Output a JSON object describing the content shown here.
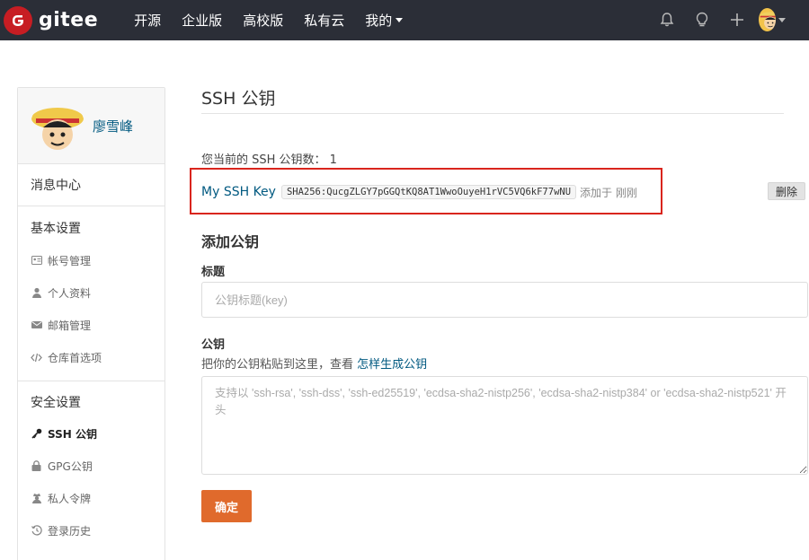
{
  "brand": {
    "name": "gitee",
    "color": "#c71d23"
  },
  "nav": {
    "links": [
      "开源",
      "企业版",
      "高校版",
      "私有云",
      "我的"
    ],
    "icons": [
      "bell-icon",
      "lightbulb-icon",
      "plus-icon",
      "user-avatar"
    ]
  },
  "sidebar": {
    "user_name": "廖雪峰",
    "message_center": "消息中心",
    "basic_header": "基本设置",
    "basic_items": [
      "帐号管理",
      "个人资料",
      "邮箱管理",
      "仓库首选项"
    ],
    "security_header": "安全设置",
    "security_items": [
      "SSH 公钥",
      "GPG公钥",
      "私人令牌",
      "登录历史"
    ]
  },
  "main": {
    "title": "SSH 公钥",
    "key_count_label": "您当前的 SSH 公钥数： 1",
    "key": {
      "name": "My SSH Key",
      "fingerprint": "SHA256:QucgZLGY7pGGQtKQ8AT1WwoOuyeH1rVC5VQ6kF77wNU",
      "added": "添加于 刚刚",
      "delete_label": "删除"
    },
    "add_title": "添加公钥",
    "title_label": "标题",
    "title_placeholder": "公钥标题(key)",
    "key_label": "公钥",
    "key_hint_text": "把你的公钥粘贴到这里，查看 ",
    "key_hint_link": "怎样生成公钥",
    "key_placeholder": "支持以 'ssh-rsa', 'ssh-dss', 'ssh-ed25519', 'ecdsa-sha2-nistp256', 'ecdsa-sha2-nistp384' or 'ecdsa-sha2-nistp521' 开头",
    "submit_label": "确定"
  },
  "colors": {
    "nav_bg": "#2b2e37",
    "link": "#005980",
    "submit": "#e06a2c",
    "highlight": "#d9251d"
  }
}
